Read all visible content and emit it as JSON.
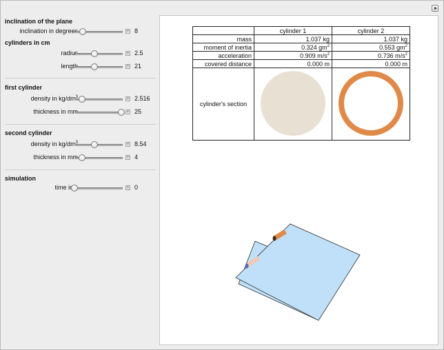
{
  "panel": {
    "section1_title": "inclination of the plane",
    "inclination_label": "inclination in degrees",
    "inclination_value": "8",
    "inclination_fraction": 0.17,
    "section2_title": "cylinders in cm",
    "radius_label": "radius",
    "radius_value": "2.5",
    "radius_fraction": 0.42,
    "length_label": "length",
    "length_value": "21",
    "length_fraction": 0.42,
    "first_title": "first cylinder",
    "first_density_label": "density in kg/dm",
    "density_exp": "3",
    "first_density_value": "2.516",
    "first_density_fraction": 0.15,
    "first_thickness_label": "thickness in mm",
    "first_thickness_value": "25",
    "first_thickness_fraction": 0.97,
    "second_title": "second cylinder",
    "second_density_label": "density in kg/dm",
    "second_density_value": "8.54",
    "second_density_fraction": 0.42,
    "second_thickness_label": "thickness in mm",
    "second_thickness_value": "4",
    "second_thickness_fraction": 0.15,
    "simulation_title": "simulation",
    "time_label": "time in s",
    "time_value": "0",
    "time_fraction": 0.0
  },
  "table": {
    "col1": "cylinder 1",
    "col2": "cylinder 2",
    "rows": [
      {
        "label": "mass",
        "c1": "1.037 kg",
        "c2": "1.037 kg"
      },
      {
        "label": "moment of inertia",
        "c1": "0.324 gm",
        "c1_sup": "2",
        "c2": "0.553 gm",
        "c2_sup": "2"
      },
      {
        "label": "acceleration",
        "c1": "0.909 m/s",
        "c1_sup": "2",
        "c2": "0.736 m/s",
        "c2_sup": "2"
      },
      {
        "label": "covered distance",
        "c1": "0.000 m",
        "c2": "0.000 m"
      }
    ],
    "section_label": "cylinder's section"
  },
  "colors": {
    "solid_section": "#e8e0d2",
    "ring_section": "#e08a4a",
    "plane": "#bfe0f8",
    "plane_edge": "#2b2b2b"
  }
}
